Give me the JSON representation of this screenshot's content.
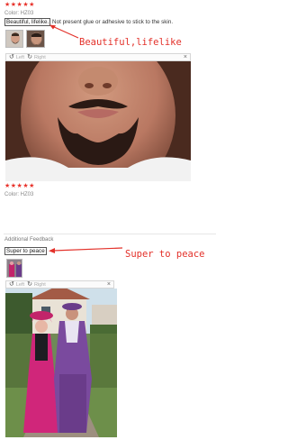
{
  "review1": {
    "stars": "★★★★★",
    "color_line": "Color: HZ03",
    "summary": "Beautiful, lifelike.",
    "body": "Not present glue or adhesive to stick to the skin.",
    "annotation": "Beautiful,lifelike",
    "toolbar": {
      "left": "Left",
      "right": "Right"
    }
  },
  "review2": {
    "stars": "★★★★★",
    "color_line": "Color: HZ03"
  },
  "feedback": {
    "heading": "Additional Feedback",
    "text": "Super to peace",
    "annotation": "Super to peace",
    "toolbar": {
      "left": "Left",
      "right": "Right"
    }
  },
  "colors": {
    "accent": "#e3312a",
    "star": "#e8322b"
  }
}
